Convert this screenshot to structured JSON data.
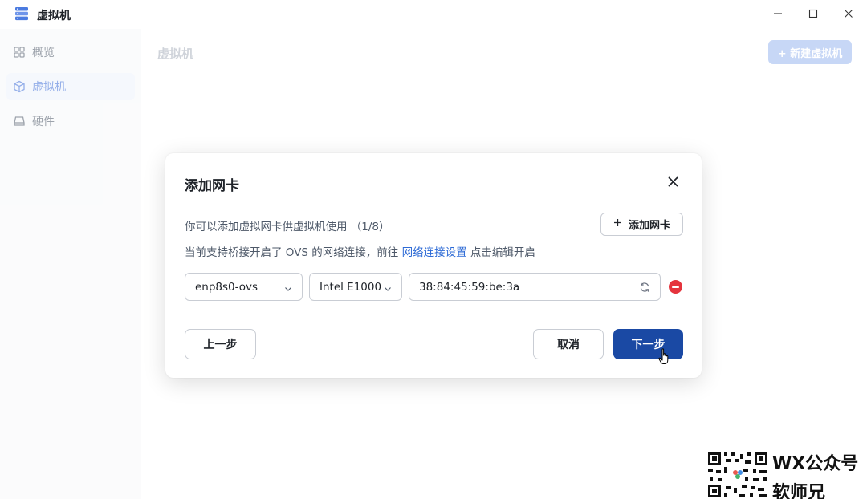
{
  "app": {
    "title": "虚拟机",
    "icon": "server-stack-icon"
  },
  "window_controls": {
    "minimize": "minimize-icon",
    "maximize": "maximize-icon",
    "close": "close-icon"
  },
  "sidebar": {
    "items": [
      {
        "label": "概览",
        "icon": "grid-icon",
        "active": false
      },
      {
        "label": "虚拟机",
        "icon": "cube-icon",
        "active": true
      },
      {
        "label": "硬件",
        "icon": "drive-icon",
        "active": false
      }
    ]
  },
  "main": {
    "title": "虚拟机",
    "new_vm_button": "+ 新建虚拟机"
  },
  "dialog": {
    "title": "添加网卡",
    "description": "你可以添加虚拟网卡供虚拟机使用 （1/8）",
    "hint_prefix": "当前支持桥接开启了 OVS 的网络连接，前往 ",
    "hint_link": "网络连接设置",
    "hint_suffix": " 点击编辑开启",
    "add_nic_button": "添加网卡",
    "nic_row": {
      "network": "enp8s0-ovs",
      "model": "Intel E1000",
      "mac": "38:84:45:59:be:3a"
    },
    "buttons": {
      "prev": "上一步",
      "cancel": "取消",
      "next": "下一步"
    }
  },
  "watermark": {
    "line1": "WX公众号",
    "line2": "软师兄"
  },
  "colors": {
    "primary": "#1a49a4",
    "link": "#2e6bd6",
    "danger": "#e5343d"
  }
}
